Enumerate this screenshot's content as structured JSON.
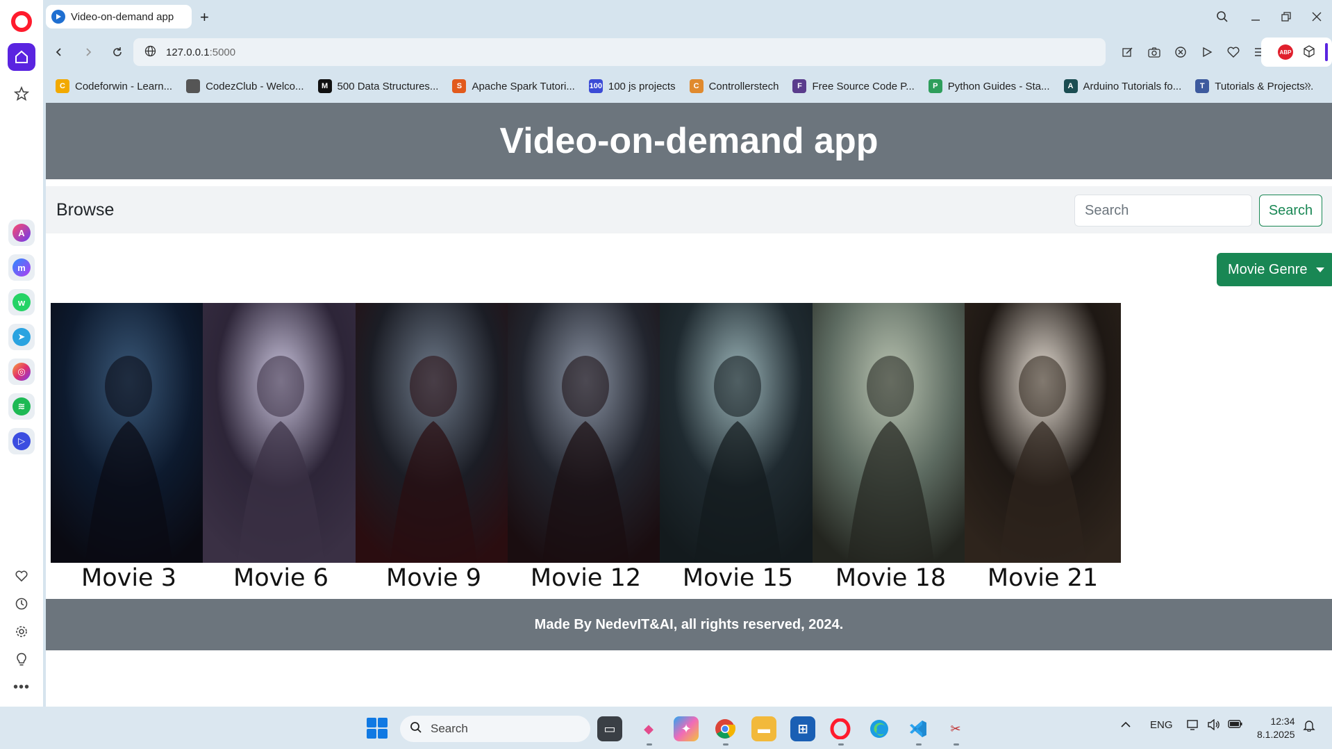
{
  "browser": {
    "tab_title": "Video-on-demand app",
    "new_tab": "+",
    "url_host": "127.0.0.1",
    "url_port": ":5000"
  },
  "bookmarks": [
    {
      "label": "Codeforwin - Learn...",
      "icon_color": "#f2a900",
      "icon": "C"
    },
    {
      "label": "CodezClub - Welco...",
      "icon_color": "#555555",
      "icon": ""
    },
    {
      "label": "500 Data Structures...",
      "icon_color": "#111111",
      "icon": "M"
    },
    {
      "label": "Apache Spark Tutori...",
      "icon_color": "#e25a1c",
      "icon": "S"
    },
    {
      "label": "100 js projects",
      "icon_color": "#3b4bd6",
      "icon": "100"
    },
    {
      "label": "Controllerstech",
      "icon_color": "#e08a2e",
      "icon": "C"
    },
    {
      "label": "Free Source Code P...",
      "icon_color": "#5a3c8c",
      "icon": "F"
    },
    {
      "label": "Python Guides - Sta...",
      "icon_color": "#2e9e5b",
      "icon": "P"
    },
    {
      "label": "Arduino Tutorials fo...",
      "icon_color": "#1b4d52",
      "icon": "A"
    },
    {
      "label": "Tutorials & Projects...",
      "icon_color": "#3d5a9e",
      "icon": "T"
    }
  ],
  "page": {
    "heading": "Video-on-demand app",
    "brand": "Browse",
    "search_placeholder": "Search",
    "search_button": "Search",
    "genre_button": "Movie Genre",
    "footer": "Made By NedevIT&AI, all rights reserved, 2024."
  },
  "movies": [
    {
      "title": "Movie 3",
      "palette": [
        "#0d1a2e",
        "#3a5878",
        "#0a0a12"
      ]
    },
    {
      "title": "Movie 6",
      "palette": [
        "#2d2538",
        "#c9c3dc",
        "#3a3044"
      ]
    },
    {
      "title": "Movie 9",
      "palette": [
        "#1b1d25",
        "#6e7a8a",
        "#2a0d10"
      ]
    },
    {
      "title": "Movie 12",
      "palette": [
        "#22252e",
        "#8a93a3",
        "#1a0d10"
      ]
    },
    {
      "title": "Movie 15",
      "palette": [
        "#1f2a30",
        "#9bb4b8",
        "#131a1d"
      ]
    },
    {
      "title": "Movie 18",
      "palette": [
        "#5c6a60",
        "#b8c2b0",
        "#23251f"
      ]
    },
    {
      "title": "Movie 21",
      "palette": [
        "#1e1814",
        "#e8e0d6",
        "#2e241c"
      ]
    }
  ],
  "taskbar": {
    "search_label": "Search",
    "language": "ENG",
    "time": "12:34",
    "date": "8.1.2025"
  },
  "colors": {
    "primary_green": "#198754",
    "hero_gray": "#6c757d",
    "opera_red": "#ff1b2d",
    "opera_purple": "#5a24e0"
  }
}
